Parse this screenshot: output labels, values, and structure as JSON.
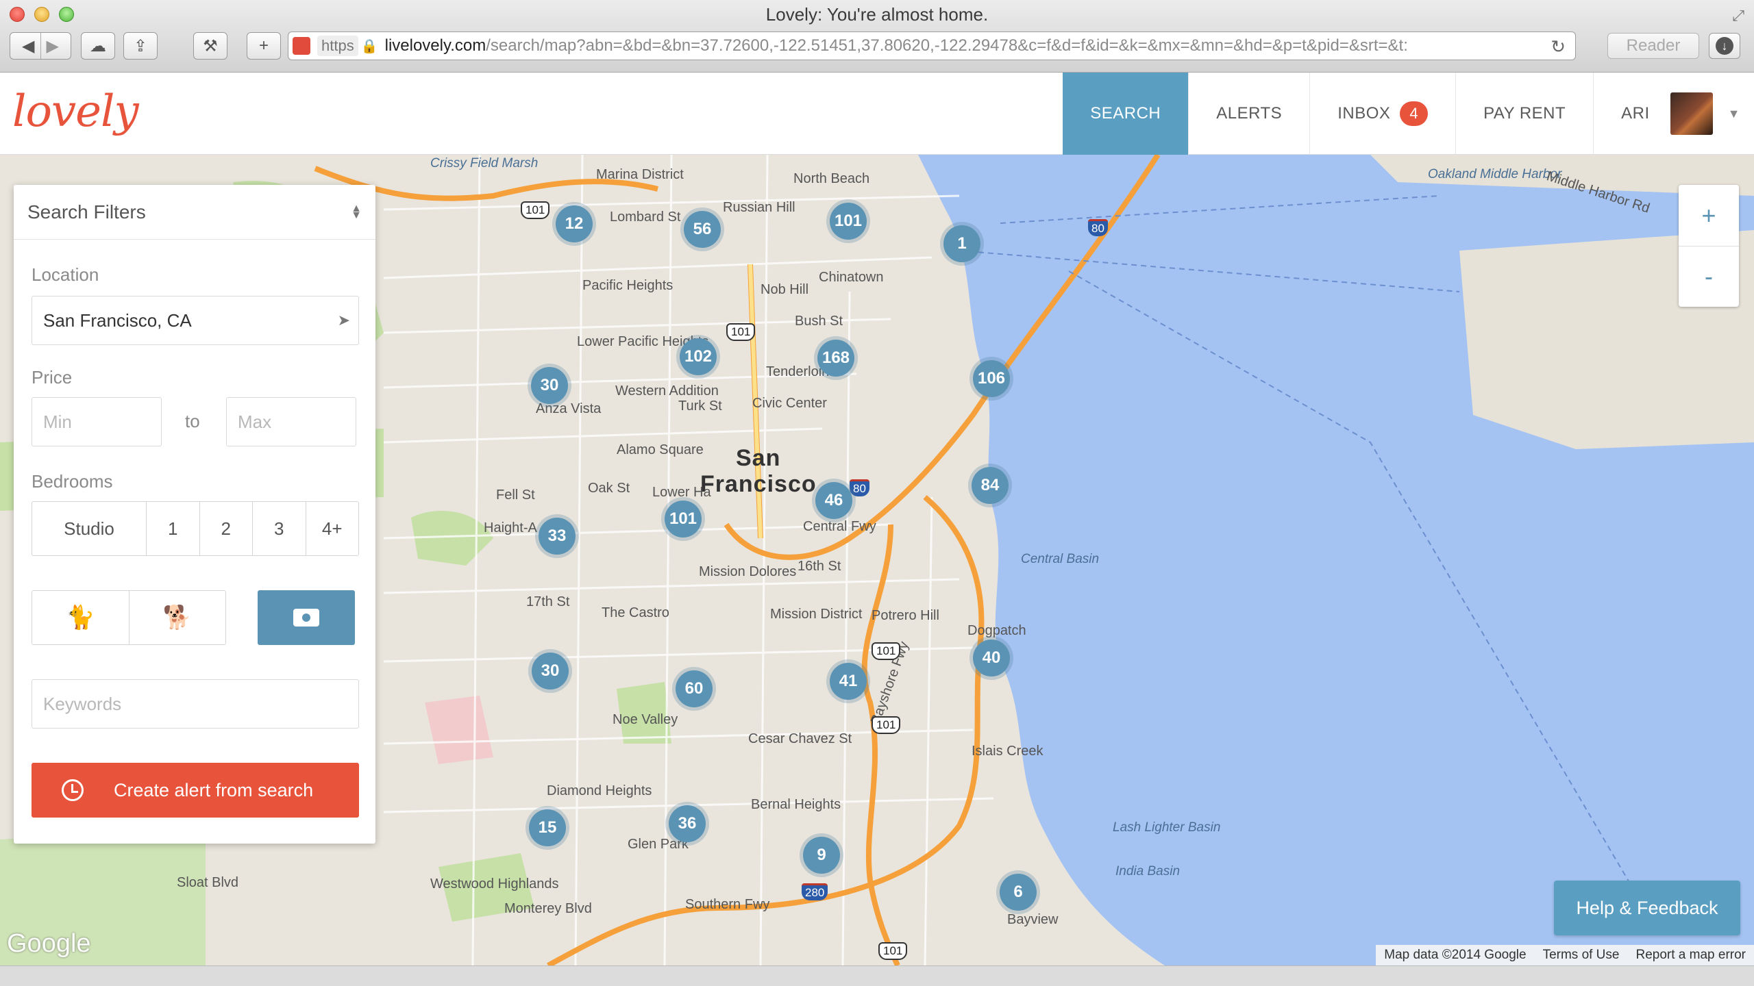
{
  "browser": {
    "window_title": "Lovely: You're almost home.",
    "url_scheme": "https",
    "url_domain": "livelovely.com",
    "url_path": "/search/map?abn=&bd=&bn=37.72600,-122.51451,37.80620,-122.29478&c=f&d=f&id=&k=&mx=&mn=&hd=&p=t&pid=&srt=&t:",
    "reader_label": "Reader"
  },
  "header": {
    "logo_text": "lovely",
    "nav": {
      "search": "SEARCH",
      "alerts": "ALERTS",
      "inbox": "INBOX",
      "inbox_count": "4",
      "pay_rent": "PAY RENT",
      "user": "ARI"
    }
  },
  "filters": {
    "title": "Search Filters",
    "location_label": "Location",
    "location_value": "San Francisco, CA",
    "price_label": "Price",
    "price_min_placeholder": "Min",
    "price_to": "to",
    "price_max_placeholder": "Max",
    "bedrooms_label": "Bedrooms",
    "bedroom_options": [
      "Studio",
      "1",
      "2",
      "3",
      "4+"
    ],
    "keywords_placeholder": "Keywords",
    "create_alert_label": "Create alert from search"
  },
  "map": {
    "zoom_in": "+",
    "zoom_out": "-",
    "help_label": "Help & Feedback",
    "google_logo": "Google",
    "footer": [
      "Map data ©2014 Google",
      "Terms of Use",
      "Report a map error"
    ],
    "city_label_1": "San",
    "city_label_2": "Francisco",
    "clusters": [
      {
        "count": "12"
      },
      {
        "count": "56"
      },
      {
        "count": "101"
      },
      {
        "count": "1"
      },
      {
        "count": "102"
      },
      {
        "count": "168"
      },
      {
        "count": "30"
      },
      {
        "count": "106"
      },
      {
        "count": "46"
      },
      {
        "count": "101"
      },
      {
        "count": "33"
      },
      {
        "count": "84"
      },
      {
        "count": "30"
      },
      {
        "count": "60"
      },
      {
        "count": "41"
      },
      {
        "count": "40"
      },
      {
        "count": "15"
      },
      {
        "count": "36"
      },
      {
        "count": "9"
      },
      {
        "count": "6"
      }
    ],
    "labels": {
      "marina": "Marina District",
      "pacific_heights": "Pacific Heights",
      "lower_pacific": "Lower Pacific Heights",
      "western_addition": "Western Addition",
      "anza_vista": "Anza Vista",
      "alamo": "Alamo Square",
      "chinatown": "Chinatown",
      "nob_hill": "Nob Hill",
      "russian_hill": "Russian Hill",
      "north_beach": "North Beach",
      "tenderloin": "Tenderloin",
      "civic_center": "Civic Center",
      "mission_dolores": "Mission Dolores",
      "mission_district": "Mission District",
      "the_castro": "The Castro",
      "potrero_hill": "Potrero Hill",
      "dogpatch": "Dogpatch",
      "noe_valley": "Noe Valley",
      "glen_park": "Glen Park",
      "bernal": "Bernal Heights",
      "diamond": "Diamond Heights",
      "westwood": "Westwood Highlands",
      "bayview": "Bayview",
      "islais": "Islais Creek",
      "india_basin": "India Basin",
      "lash_lighter": "Lash Lighter Basin",
      "central_basin": "Central Basin",
      "oakland": "Oakland Middle Harbor",
      "middle_harbor_rd": "Middle Harbor Rd",
      "haight": "Haight-A",
      "crissy": "Crissy Field Marsh",
      "lower_haight": "Lower Ha",
      "lombard": "Lombard St",
      "bush": "Bush St",
      "turk": "Turk St",
      "fell": "Fell St",
      "oak": "Oak St",
      "sixteenth": "16th St",
      "seventeenth": "17th St",
      "cesar": "Cesar Chavez St",
      "bayshore": "Bayshore Fwy",
      "southern": "Southern Fwy",
      "monterey": "Monterey Blvd",
      "sloat": "Sloat Blvd",
      "central_fwy": "Central Fwy"
    }
  }
}
